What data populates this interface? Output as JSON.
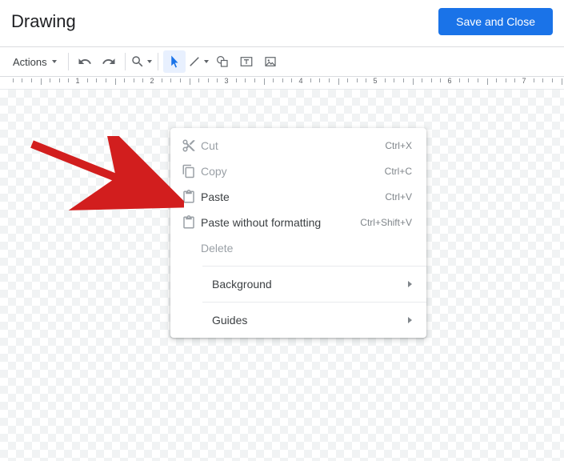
{
  "header": {
    "title": "Drawing",
    "save_label": "Save and Close"
  },
  "toolbar": {
    "actions_label": "Actions"
  },
  "ruler": {
    "numbers": [
      1,
      2,
      3,
      4,
      5,
      6,
      7
    ]
  },
  "context_menu": {
    "items": [
      {
        "label": "Cut",
        "shortcut": "Ctrl+X",
        "icon": "cut",
        "disabled": true
      },
      {
        "label": "Copy",
        "shortcut": "Ctrl+C",
        "icon": "copy",
        "disabled": true
      },
      {
        "label": "Paste",
        "shortcut": "Ctrl+V",
        "icon": "paste",
        "disabled": false
      },
      {
        "label": "Paste without formatting",
        "shortcut": "Ctrl+Shift+V",
        "icon": "paste",
        "disabled": false
      },
      {
        "label": "Delete",
        "shortcut": "",
        "icon": "",
        "disabled": true
      }
    ],
    "submenu_items": [
      {
        "label": "Background"
      },
      {
        "label": "Guides"
      }
    ]
  }
}
